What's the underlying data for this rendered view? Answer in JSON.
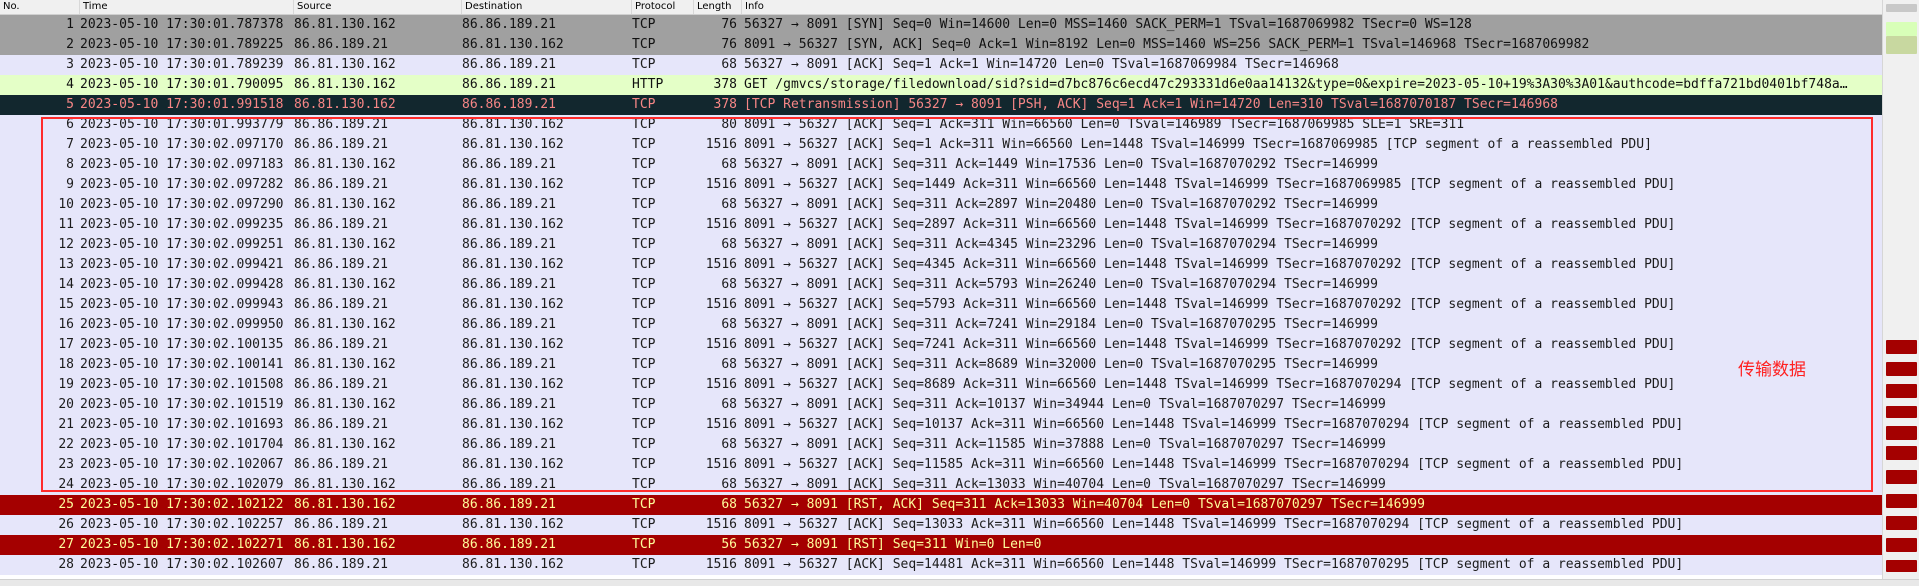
{
  "columns": {
    "no": "No.",
    "time": "Time",
    "source": "Source",
    "destination": "Destination",
    "protocol": "Protocol",
    "length": "Length",
    "info": "Info"
  },
  "colors": {
    "syn": "#a0a0a0",
    "http": "#e4ffc7",
    "selected": "#12272e",
    "rst": "#a40000",
    "tcp": "#e6e6fa",
    "annotation": "#ff2b2b"
  },
  "packets": [
    {
      "no": "1",
      "time": "2023-05-10 17:30:01.787378",
      "src": "86.81.130.162",
      "dst": "86.86.189.21",
      "proto": "TCP",
      "len": "76",
      "info": "56327 → 8091 [SYN] Seq=0 Win=14600 Len=0 MSS=1460 SACK_PERM=1 TSval=1687069982 TSecr=0 WS=128",
      "style": "syn"
    },
    {
      "no": "2",
      "time": "2023-05-10 17:30:01.789225",
      "src": "86.86.189.21",
      "dst": "86.81.130.162",
      "proto": "TCP",
      "len": "76",
      "info": "8091 → 56327 [SYN, ACK] Seq=0 Ack=1 Win=8192 Len=0 MSS=1460 WS=256 SACK_PERM=1 TSval=146968 TSecr=1687069982",
      "style": "syn"
    },
    {
      "no": "3",
      "time": "2023-05-10 17:30:01.789239",
      "src": "86.81.130.162",
      "dst": "86.86.189.21",
      "proto": "TCP",
      "len": "68",
      "info": "56327 → 8091 [ACK] Seq=1 Ack=1 Win=14720 Len=0 TSval=1687069984 TSecr=146968",
      "style": "tcp"
    },
    {
      "no": "4",
      "time": "2023-05-10 17:30:01.790095",
      "src": "86.81.130.162",
      "dst": "86.86.189.21",
      "proto": "HTTP",
      "len": "378",
      "info": "GET /gmvcs/storage/filedownload/sid?sid=d7bc876c6ecd47c293331d6e0aa14132&type=0&expire=2023-05-10+19%3A30%3A01&authcode=bdffa721bd0401bf748a…",
      "style": "http"
    },
    {
      "no": "5",
      "time": "2023-05-10 17:30:01.991518",
      "src": "86.81.130.162",
      "dst": "86.86.189.21",
      "proto": "TCP",
      "len": "378",
      "info": "[TCP Retransmission] 56327 → 8091 [PSH, ACK] Seq=1 Ack=1 Win=14720 Len=310 TSval=1687070187 TSecr=146968",
      "style": "sel"
    },
    {
      "no": "6",
      "time": "2023-05-10 17:30:01.993779",
      "src": "86.86.189.21",
      "dst": "86.81.130.162",
      "proto": "TCP",
      "len": "80",
      "info": "8091 → 56327 [ACK] Seq=1 Ack=311 Win=66560 Len=0 TSval=146989 TSecr=1687069985 SLE=1 SRE=311",
      "style": "tcp"
    },
    {
      "no": "7",
      "time": "2023-05-10 17:30:02.097170",
      "src": "86.86.189.21",
      "dst": "86.81.130.162",
      "proto": "TCP",
      "len": "1516",
      "info": "8091 → 56327 [ACK] Seq=1 Ack=311 Win=66560 Len=1448 TSval=146999 TSecr=1687069985 [TCP segment of a reassembled PDU]",
      "style": "tcp"
    },
    {
      "no": "8",
      "time": "2023-05-10 17:30:02.097183",
      "src": "86.81.130.162",
      "dst": "86.86.189.21",
      "proto": "TCP",
      "len": "68",
      "info": "56327 → 8091 [ACK] Seq=311 Ack=1449 Win=17536 Len=0 TSval=1687070292 TSecr=146999",
      "style": "tcp"
    },
    {
      "no": "9",
      "time": "2023-05-10 17:30:02.097282",
      "src": "86.86.189.21",
      "dst": "86.81.130.162",
      "proto": "TCP",
      "len": "1516",
      "info": "8091 → 56327 [ACK] Seq=1449 Ack=311 Win=66560 Len=1448 TSval=146999 TSecr=1687069985 [TCP segment of a reassembled PDU]",
      "style": "tcp"
    },
    {
      "no": "10",
      "time": "2023-05-10 17:30:02.097290",
      "src": "86.81.130.162",
      "dst": "86.86.189.21",
      "proto": "TCP",
      "len": "68",
      "info": "56327 → 8091 [ACK] Seq=311 Ack=2897 Win=20480 Len=0 TSval=1687070292 TSecr=146999",
      "style": "tcp"
    },
    {
      "no": "11",
      "time": "2023-05-10 17:30:02.099235",
      "src": "86.86.189.21",
      "dst": "86.81.130.162",
      "proto": "TCP",
      "len": "1516",
      "info": "8091 → 56327 [ACK] Seq=2897 Ack=311 Win=66560 Len=1448 TSval=146999 TSecr=1687070292 [TCP segment of a reassembled PDU]",
      "style": "tcp"
    },
    {
      "no": "12",
      "time": "2023-05-10 17:30:02.099251",
      "src": "86.81.130.162",
      "dst": "86.86.189.21",
      "proto": "TCP",
      "len": "68",
      "info": "56327 → 8091 [ACK] Seq=311 Ack=4345 Win=23296 Len=0 TSval=1687070294 TSecr=146999",
      "style": "tcp"
    },
    {
      "no": "13",
      "time": "2023-05-10 17:30:02.099421",
      "src": "86.86.189.21",
      "dst": "86.81.130.162",
      "proto": "TCP",
      "len": "1516",
      "info": "8091 → 56327 [ACK] Seq=4345 Ack=311 Win=66560 Len=1448 TSval=146999 TSecr=1687070292 [TCP segment of a reassembled PDU]",
      "style": "tcp"
    },
    {
      "no": "14",
      "time": "2023-05-10 17:30:02.099428",
      "src": "86.81.130.162",
      "dst": "86.86.189.21",
      "proto": "TCP",
      "len": "68",
      "info": "56327 → 8091 [ACK] Seq=311 Ack=5793 Win=26240 Len=0 TSval=1687070294 TSecr=146999",
      "style": "tcp"
    },
    {
      "no": "15",
      "time": "2023-05-10 17:30:02.099943",
      "src": "86.86.189.21",
      "dst": "86.81.130.162",
      "proto": "TCP",
      "len": "1516",
      "info": "8091 → 56327 [ACK] Seq=5793 Ack=311 Win=66560 Len=1448 TSval=146999 TSecr=1687070292 [TCP segment of a reassembled PDU]",
      "style": "tcp"
    },
    {
      "no": "16",
      "time": "2023-05-10 17:30:02.099950",
      "src": "86.81.130.162",
      "dst": "86.86.189.21",
      "proto": "TCP",
      "len": "68",
      "info": "56327 → 8091 [ACK] Seq=311 Ack=7241 Win=29184 Len=0 TSval=1687070295 TSecr=146999",
      "style": "tcp"
    },
    {
      "no": "17",
      "time": "2023-05-10 17:30:02.100135",
      "src": "86.86.189.21",
      "dst": "86.81.130.162",
      "proto": "TCP",
      "len": "1516",
      "info": "8091 → 56327 [ACK] Seq=7241 Ack=311 Win=66560 Len=1448 TSval=146999 TSecr=1687070292 [TCP segment of a reassembled PDU]",
      "style": "tcp"
    },
    {
      "no": "18",
      "time": "2023-05-10 17:30:02.100141",
      "src": "86.81.130.162",
      "dst": "86.86.189.21",
      "proto": "TCP",
      "len": "68",
      "info": "56327 → 8091 [ACK] Seq=311 Ack=8689 Win=32000 Len=0 TSval=1687070295 TSecr=146999",
      "style": "tcp"
    },
    {
      "no": "19",
      "time": "2023-05-10 17:30:02.101508",
      "src": "86.86.189.21",
      "dst": "86.81.130.162",
      "proto": "TCP",
      "len": "1516",
      "info": "8091 → 56327 [ACK] Seq=8689 Ack=311 Win=66560 Len=1448 TSval=146999 TSecr=1687070294 [TCP segment of a reassembled PDU]",
      "style": "tcp"
    },
    {
      "no": "20",
      "time": "2023-05-10 17:30:02.101519",
      "src": "86.81.130.162",
      "dst": "86.86.189.21",
      "proto": "TCP",
      "len": "68",
      "info": "56327 → 8091 [ACK] Seq=311 Ack=10137 Win=34944 Len=0 TSval=1687070297 TSecr=146999",
      "style": "tcp"
    },
    {
      "no": "21",
      "time": "2023-05-10 17:30:02.101693",
      "src": "86.86.189.21",
      "dst": "86.81.130.162",
      "proto": "TCP",
      "len": "1516",
      "info": "8091 → 56327 [ACK] Seq=10137 Ack=311 Win=66560 Len=1448 TSval=146999 TSecr=1687070294 [TCP segment of a reassembled PDU]",
      "style": "tcp"
    },
    {
      "no": "22",
      "time": "2023-05-10 17:30:02.101704",
      "src": "86.81.130.162",
      "dst": "86.86.189.21",
      "proto": "TCP",
      "len": "68",
      "info": "56327 → 8091 [ACK] Seq=311 Ack=11585 Win=37888 Len=0 TSval=1687070297 TSecr=146999",
      "style": "tcp"
    },
    {
      "no": "23",
      "time": "2023-05-10 17:30:02.102067",
      "src": "86.86.189.21",
      "dst": "86.81.130.162",
      "proto": "TCP",
      "len": "1516",
      "info": "8091 → 56327 [ACK] Seq=11585 Ack=311 Win=66560 Len=1448 TSval=146999 TSecr=1687070294 [TCP segment of a reassembled PDU]",
      "style": "tcp"
    },
    {
      "no": "24",
      "time": "2023-05-10 17:30:02.102079",
      "src": "86.81.130.162",
      "dst": "86.86.189.21",
      "proto": "TCP",
      "len": "68",
      "info": "56327 → 8091 [ACK] Seq=311 Ack=13033 Win=40704 Len=0 TSval=1687070297 TSecr=146999",
      "style": "tcp"
    },
    {
      "no": "25",
      "time": "2023-05-10 17:30:02.102122",
      "src": "86.81.130.162",
      "dst": "86.86.189.21",
      "proto": "TCP",
      "len": "68",
      "info": "56327 → 8091 [RST, ACK] Seq=311 Ack=13033 Win=40704 Len=0 TSval=1687070297 TSecr=146999",
      "style": "rst"
    },
    {
      "no": "26",
      "time": "2023-05-10 17:30:02.102257",
      "src": "86.86.189.21",
      "dst": "86.81.130.162",
      "proto": "TCP",
      "len": "1516",
      "info": "8091 → 56327 [ACK] Seq=13033 Ack=311 Win=66560 Len=1448 TSval=146999 TSecr=1687070294 [TCP segment of a reassembled PDU]",
      "style": "tcp"
    },
    {
      "no": "27",
      "time": "2023-05-10 17:30:02.102271",
      "src": "86.81.130.162",
      "dst": "86.86.189.21",
      "proto": "TCP",
      "len": "56",
      "info": "56327 → 8091 [RST] Seq=311 Win=0 Len=0",
      "style": "rst"
    },
    {
      "no": "28",
      "time": "2023-05-10 17:30:02.102607",
      "src": "86.86.189.21",
      "dst": "86.81.130.162",
      "proto": "TCP",
      "len": "1516",
      "info": "8091 → 56327 [ACK] Seq=14481 Ack=311 Win=66560 Len=1448 TSval=146999 TSecr=1687070295 [TCP segment of a reassembled PDU]",
      "style": "tcp"
    }
  ],
  "annotation": {
    "label": "传输数据"
  }
}
